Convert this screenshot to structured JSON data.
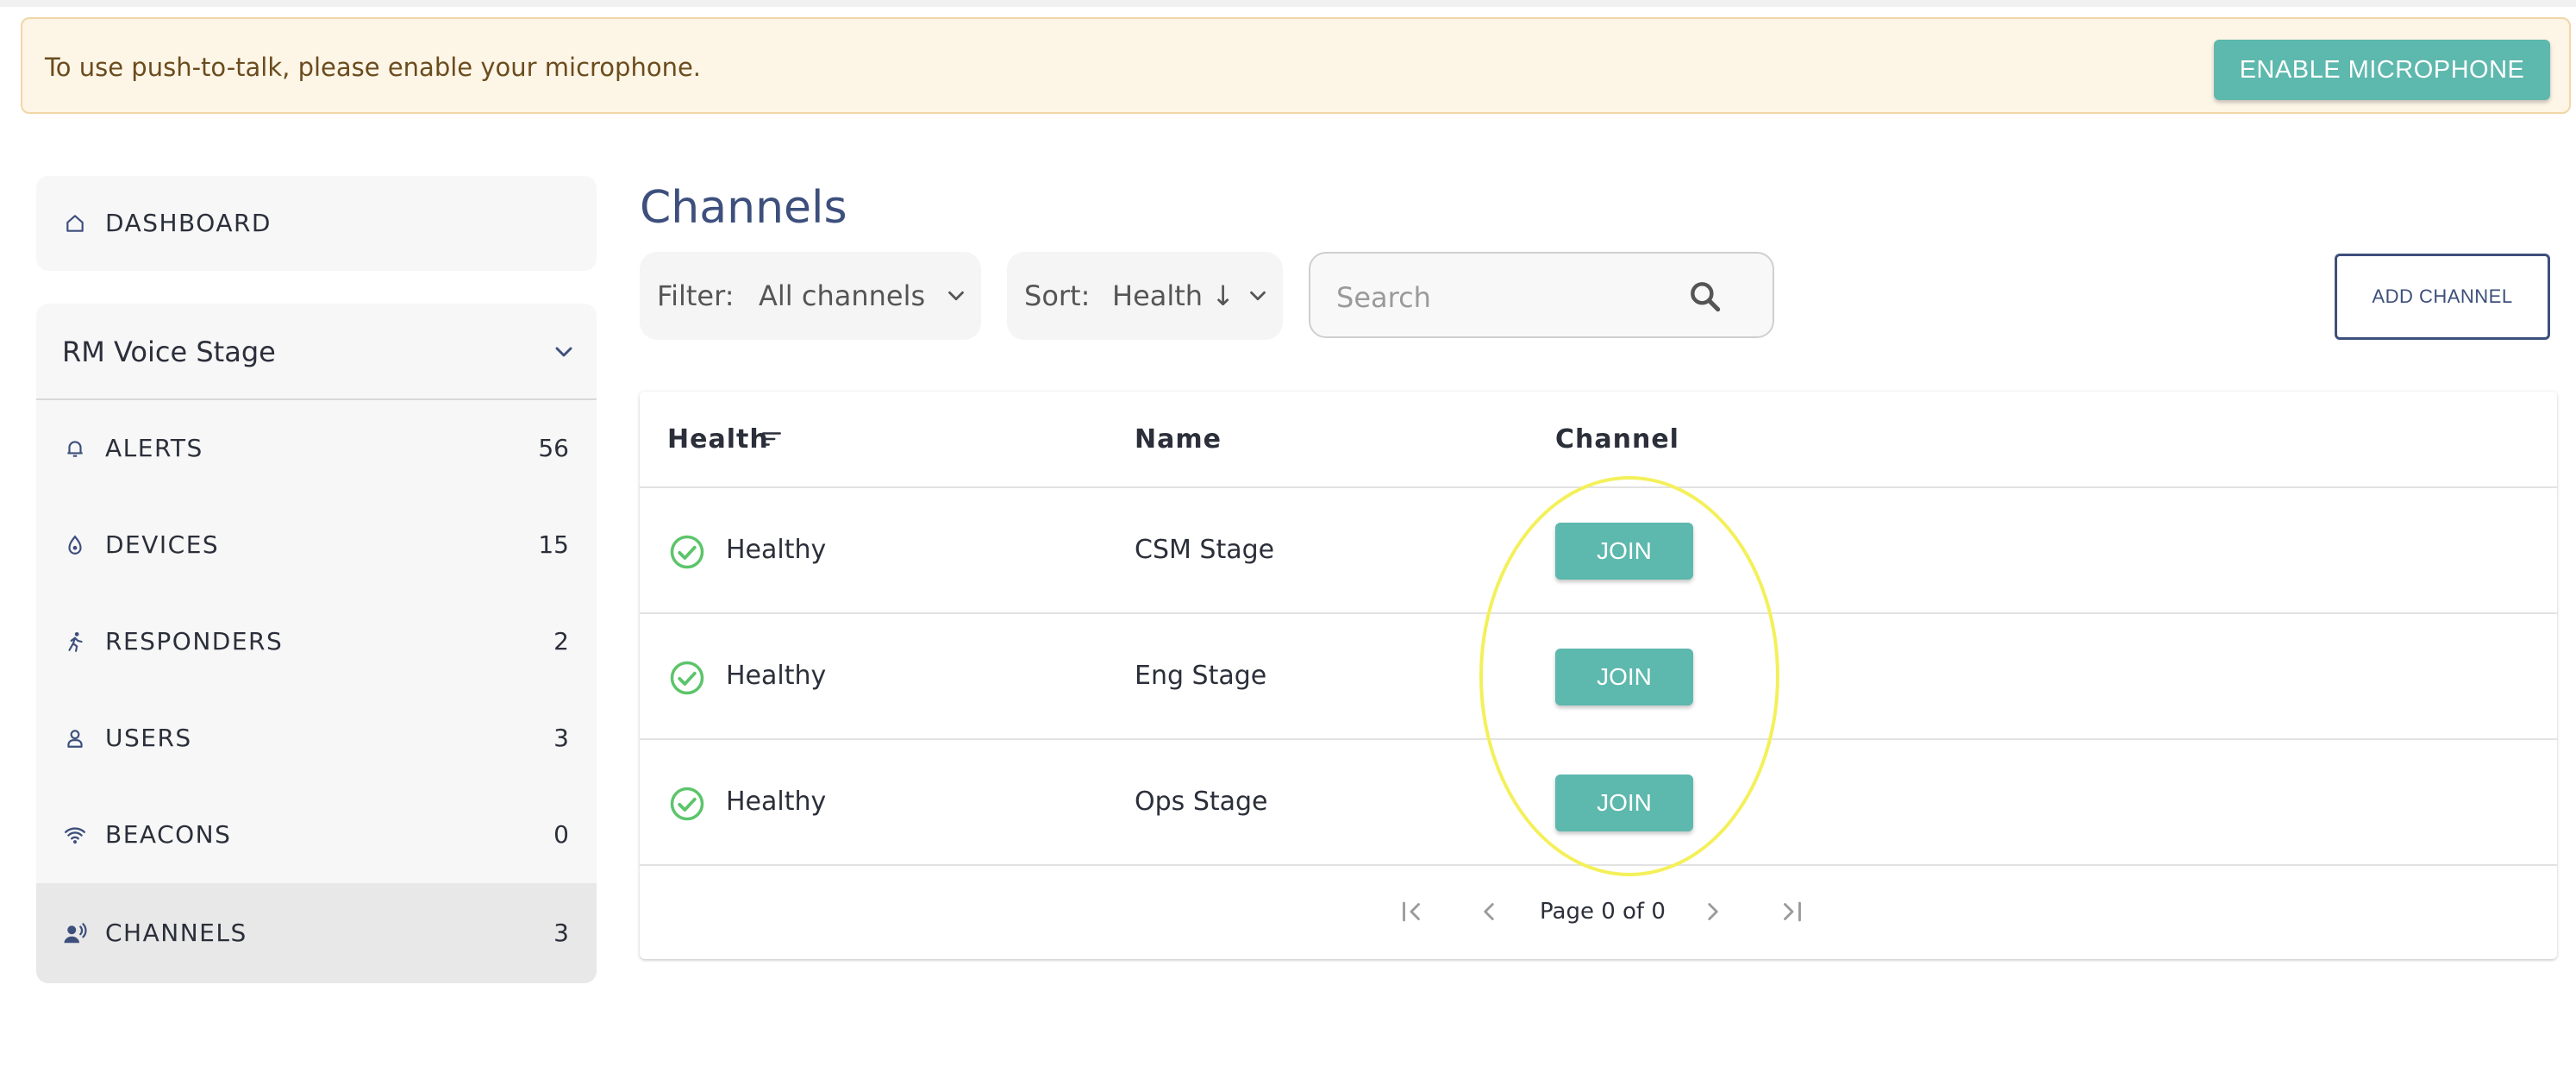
{
  "banner": {
    "message": "To use push-to-talk, please enable your microphone.",
    "button_label": "ENABLE MICROPHONE"
  },
  "sidebar": {
    "dashboard": {
      "label": "DASHBOARD",
      "icon": "home-icon"
    },
    "org": {
      "name": "RM Voice Stage",
      "icon": "chevron-down-icon"
    },
    "items": [
      {
        "label": "ALERTS",
        "count": "56",
        "icon": "bell-icon"
      },
      {
        "label": "DEVICES",
        "count": "15",
        "icon": "device-icon"
      },
      {
        "label": "RESPONDERS",
        "count": "2",
        "icon": "runner-icon"
      },
      {
        "label": "USERS",
        "count": "3",
        "icon": "user-icon"
      },
      {
        "label": "BEACONS",
        "count": "0",
        "icon": "wifi-icon"
      },
      {
        "label": "CHANNELS",
        "count": "3",
        "icon": "speaker-icon",
        "active": true
      }
    ]
  },
  "main": {
    "title": "Channels",
    "filter": {
      "label": "Filter:",
      "value": "All channels"
    },
    "sort": {
      "label": "Sort:",
      "value": "Health ↓"
    },
    "search": {
      "placeholder": "Search",
      "value": ""
    },
    "add_button": "ADD CHANNEL",
    "table": {
      "headers": [
        "Health",
        "Name",
        "Channel"
      ],
      "rows": [
        {
          "health": "Healthy",
          "name": "CSM Stage",
          "action": "JOIN"
        },
        {
          "health": "Healthy",
          "name": "Eng Stage",
          "action": "JOIN"
        },
        {
          "health": "Healthy",
          "name": "Ops Stage",
          "action": "JOIN"
        }
      ]
    },
    "pagination": {
      "text": "Page 0 of 0"
    }
  },
  "colors": {
    "accent": "#5db8ad",
    "title": "#3d4f7c",
    "banner_bg": "#fdf5e6",
    "healthy": "#5cc46a",
    "annotation": "#f4f05a"
  }
}
